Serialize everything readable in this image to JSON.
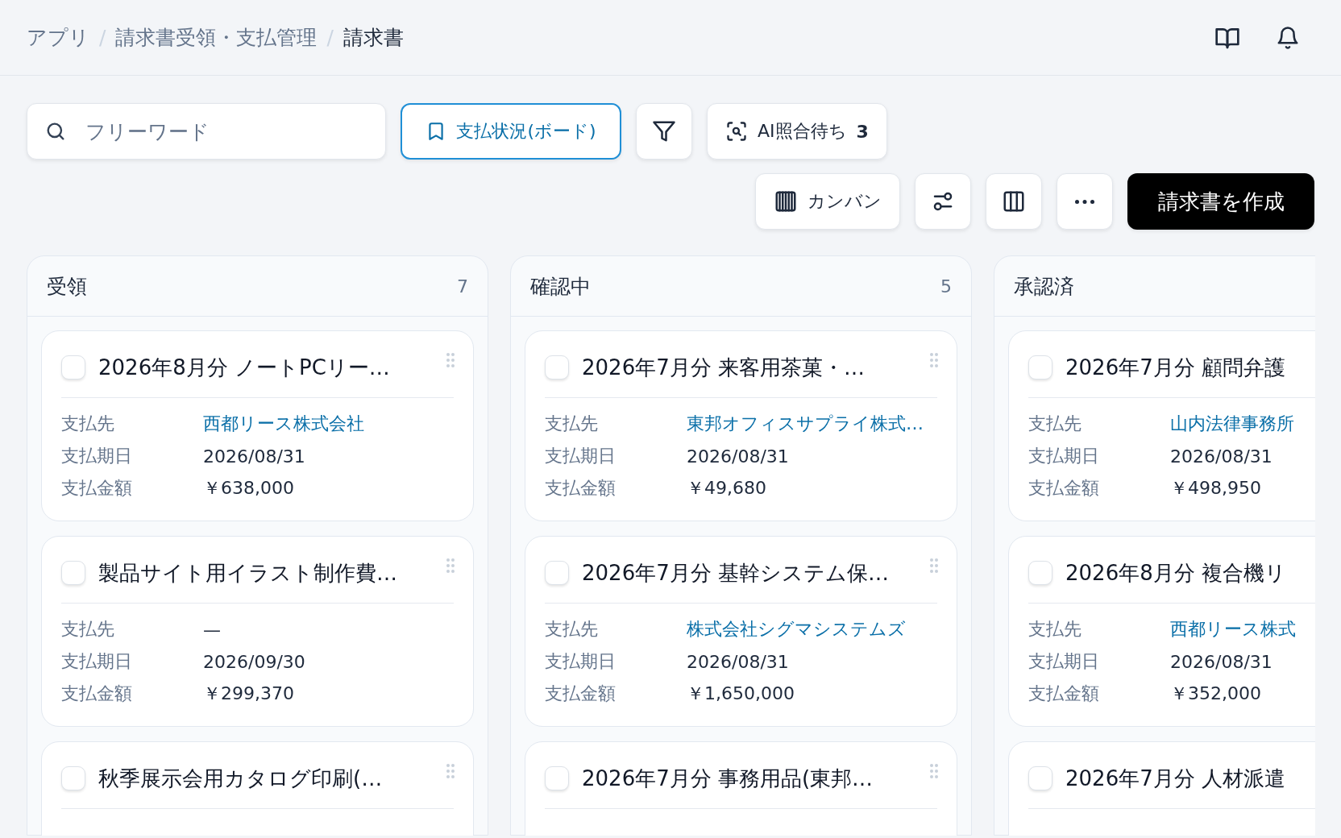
{
  "breadcrumb_separator": "/",
  "breadcrumb": [
    {
      "label": "アプリ",
      "current": false
    },
    {
      "label": "請求書受領・支払管理",
      "current": false
    },
    {
      "label": "請求書",
      "current": true
    }
  ],
  "search": {
    "placeholder": "フリーワード"
  },
  "saved_view": {
    "label": "支払状況(ボード)",
    "active": true
  },
  "ai_button": {
    "label": "AI照合待ち",
    "count": "3"
  },
  "view_button": {
    "label": "カンバン"
  },
  "create_button": {
    "label": "請求書を作成"
  },
  "columns": [
    {
      "title": "受領",
      "count": "7",
      "cards": [
        {
          "title": "2026年8月分 ノートPCリー…",
          "checked": false,
          "fields": [
            {
              "label": "支払先",
              "value": "西都リース株式会社",
              "link": true
            },
            {
              "label": "支払期日",
              "value": "2026/08/31",
              "link": false
            },
            {
              "label": "支払金額",
              "value": "￥638,000",
              "link": false
            }
          ]
        },
        {
          "title": "製品サイト用イラスト制作費…",
          "checked": false,
          "fields": [
            {
              "label": "支払先",
              "value": "—",
              "link": false
            },
            {
              "label": "支払期日",
              "value": "2026/09/30",
              "link": false
            },
            {
              "label": "支払金額",
              "value": "￥299,370",
              "link": false
            }
          ]
        },
        {
          "title": "秋季展示会用カタログ印刷(…",
          "checked": false
        }
      ]
    },
    {
      "title": "確認中",
      "count": "5",
      "cards": [
        {
          "title": "2026年7月分 来客用茶菓・…",
          "checked": false,
          "fields": [
            {
              "label": "支払先",
              "value": "東邦オフィスサプライ株式…",
              "link": true
            },
            {
              "label": "支払期日",
              "value": "2026/08/31",
              "link": false
            },
            {
              "label": "支払金額",
              "value": "￥49,680",
              "link": false
            }
          ]
        },
        {
          "title": "2026年7月分 基幹システム保…",
          "checked": false,
          "fields": [
            {
              "label": "支払先",
              "value": "株式会社シグマシステムズ",
              "link": true
            },
            {
              "label": "支払期日",
              "value": "2026/08/31",
              "link": false
            },
            {
              "label": "支払金額",
              "value": "￥1,650,000",
              "link": false
            }
          ]
        },
        {
          "title": "2026年7月分 事務用品(東邦…",
          "checked": false
        }
      ]
    },
    {
      "title": "承認済",
      "cards": [
        {
          "title": "2026年7月分 顧問弁護",
          "checked": false,
          "fields": [
            {
              "label": "支払先",
              "value": "山内法律事務所",
              "link": true
            },
            {
              "label": "支払期日",
              "value": "2026/08/31",
              "link": false
            },
            {
              "label": "支払金額",
              "value": "￥498,950",
              "link": false
            }
          ]
        },
        {
          "title": "2026年8月分 複合機リ",
          "checked": false,
          "fields": [
            {
              "label": "支払先",
              "value": "西都リース株式",
              "link": true
            },
            {
              "label": "支払期日",
              "value": "2026/08/31",
              "link": false
            },
            {
              "label": "支払金額",
              "value": "￥352,000",
              "link": false
            }
          ]
        },
        {
          "title": "2026年7月分 人材派遣",
          "checked": false
        }
      ]
    }
  ]
}
